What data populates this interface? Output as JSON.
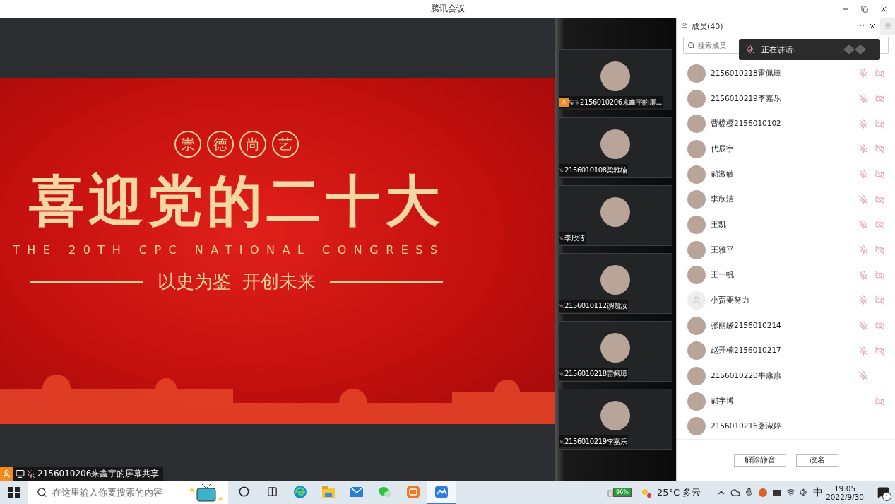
{
  "window": {
    "title": "腾讯会议"
  },
  "share": {
    "slide": {
      "motto": [
        "崇",
        "德",
        "尚",
        "艺"
      ],
      "headline": "喜迎党的二十大",
      "english": "THE 20TH CPC NATIONAL CONGRESS",
      "slogan": "以史为鉴  开创未来"
    },
    "presenter": {
      "host": true,
      "sharing": true,
      "mic_muted": true,
      "name": "2156010206来鑫宇的屏幕共享"
    }
  },
  "tiles": [
    {
      "name": "2156010206来鑫宇的屏...",
      "host": true,
      "sharing": true,
      "mic_muted": true
    },
    {
      "name": "2156010108梁雅楠",
      "host": false,
      "sharing": false,
      "mic_muted": true
    },
    {
      "name": "李欣洁",
      "host": false,
      "sharing": false,
      "mic_muted": true
    },
    {
      "name": "2156010112谈咖汝",
      "host": false,
      "sharing": false,
      "mic_muted": true
    },
    {
      "name": "2156010218雷佩璋",
      "host": false,
      "sharing": false,
      "mic_muted": true
    },
    {
      "name": "2156010219李嘉乐",
      "host": false,
      "sharing": false,
      "mic_muted": true
    }
  ],
  "members_panel": {
    "title": "成员(40)",
    "more": "···",
    "search": {
      "placeholder": "搜索成员"
    },
    "speaking": {
      "label": "正在讲话:"
    },
    "members": [
      {
        "name": "2156010218雷佩璋",
        "default_avatar": false,
        "mic_muted": true,
        "camera_off": true
      },
      {
        "name": "2156010219李嘉乐",
        "default_avatar": false,
        "mic_muted": true,
        "camera_off": true
      },
      {
        "name": "曹檔樱2156010102",
        "default_avatar": false,
        "mic_muted": true,
        "camera_off": true
      },
      {
        "name": "代辰宇",
        "default_avatar": false,
        "mic_muted": true,
        "camera_off": true
      },
      {
        "name": "郝淑敏",
        "default_avatar": false,
        "mic_muted": true,
        "camera_off": true
      },
      {
        "name": "李欣洁",
        "default_avatar": false,
        "mic_muted": true,
        "camera_off": true
      },
      {
        "name": "王凯",
        "default_avatar": false,
        "mic_muted": true,
        "camera_off": true
      },
      {
        "name": "王雅平",
        "default_avatar": false,
        "mic_muted": true,
        "camera_off": true
      },
      {
        "name": "王一帆",
        "default_avatar": false,
        "mic_muted": true,
        "camera_off": true
      },
      {
        "name": "小贾要努力",
        "default_avatar": true,
        "mic_muted": true,
        "camera_off": true
      },
      {
        "name": "张丽缘2156010214",
        "default_avatar": false,
        "mic_muted": true,
        "camera_off": true
      },
      {
        "name": "赵开楠2156010217",
        "default_avatar": false,
        "mic_muted": true,
        "camera_off": true
      },
      {
        "name": "2156010220牛康康",
        "default_avatar": false,
        "mic_muted": true,
        "camera_off": false
      },
      {
        "name": "郝宇博",
        "default_avatar": false,
        "mic_muted": false,
        "camera_off": true
      },
      {
        "name": "2156010216张淑婷",
        "default_avatar": false,
        "mic_muted": false,
        "camera_off": false
      }
    ],
    "buttons": [
      "解除静音",
      "改名"
    ]
  },
  "taskbar": {
    "search": {
      "placeholder": "在这里输入你要搜索的内容"
    },
    "apps": [
      {
        "kind": "browser",
        "active": false
      },
      {
        "kind": "folder",
        "active": false
      },
      {
        "kind": "mail",
        "active": false
      },
      {
        "kind": "chat",
        "active": false
      },
      {
        "kind": "video",
        "active": false
      },
      {
        "kind": "meeting",
        "active": true
      }
    ],
    "battery": "96%",
    "weather": "25°C 多云",
    "ime": "中",
    "time": "19:05",
    "date": "2022/9/30",
    "notifications": "1"
  }
}
